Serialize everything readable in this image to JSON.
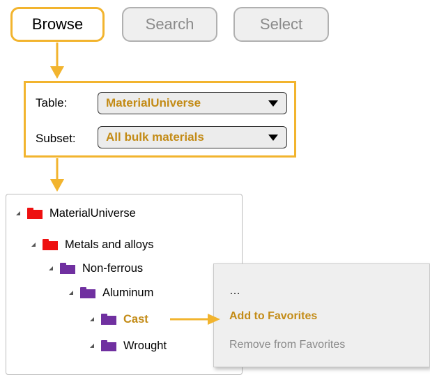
{
  "tabs": {
    "browse": "Browse",
    "search": "Search",
    "select": "Select"
  },
  "table_row": {
    "label": "Table:",
    "value": "MaterialUniverse"
  },
  "subset_row": {
    "label": "Subset:",
    "value": "All bulk materials"
  },
  "tree": {
    "nodes": [
      {
        "label": "MaterialUniverse",
        "folder": "red"
      },
      {
        "label": "Metals and alloys",
        "folder": "red"
      },
      {
        "label": "Non-ferrous",
        "folder": "purple"
      },
      {
        "label": "Aluminum",
        "folder": "purple"
      },
      {
        "label": "Cast",
        "folder": "purple",
        "highlighted": true
      },
      {
        "label": "Wrought",
        "folder": "purple"
      }
    ]
  },
  "context_menu": {
    "item_more": "…",
    "item_add": "Add to Favorites",
    "item_remove": "Remove from Favorites"
  },
  "colors": {
    "accent": "#f2b42e",
    "highlight_text": "#c38b16",
    "folder_red": "#ee1010",
    "folder_purple": "#7030a0"
  }
}
